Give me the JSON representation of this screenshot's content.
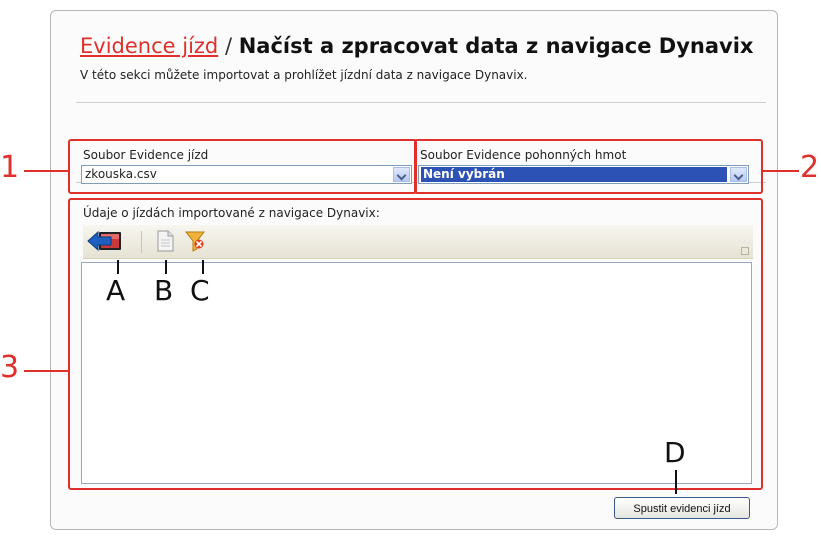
{
  "header": {
    "breadcrumb_link": "Evidence jízd",
    "separator": "/",
    "title": "Načíst a zpracovat data z navigace Dynavix",
    "subtitle": "V této sekci můžete importovat a prohlížet jízdní data z navigace Dynavix."
  },
  "trip_file": {
    "label": "Soubor Evidence jízd",
    "value": "zkouska.csv"
  },
  "fuel_file": {
    "label": "Soubor Evidence pohonných hmot",
    "value": "Není vybrán"
  },
  "trips": {
    "label": "Údaje o jízdách importované z navigace Dynavix:",
    "toolbar": {
      "import_icon": "import-arrow-icon",
      "document_icon": "document-icon",
      "filter_icon": "filter-icon"
    },
    "rows": []
  },
  "run_button": "Spustit evidenci jízd",
  "annotations": {
    "callouts": [
      "1",
      "2",
      "3"
    ],
    "letters": [
      "A",
      "B",
      "C",
      "D"
    ],
    "color": "#e0302c"
  }
}
